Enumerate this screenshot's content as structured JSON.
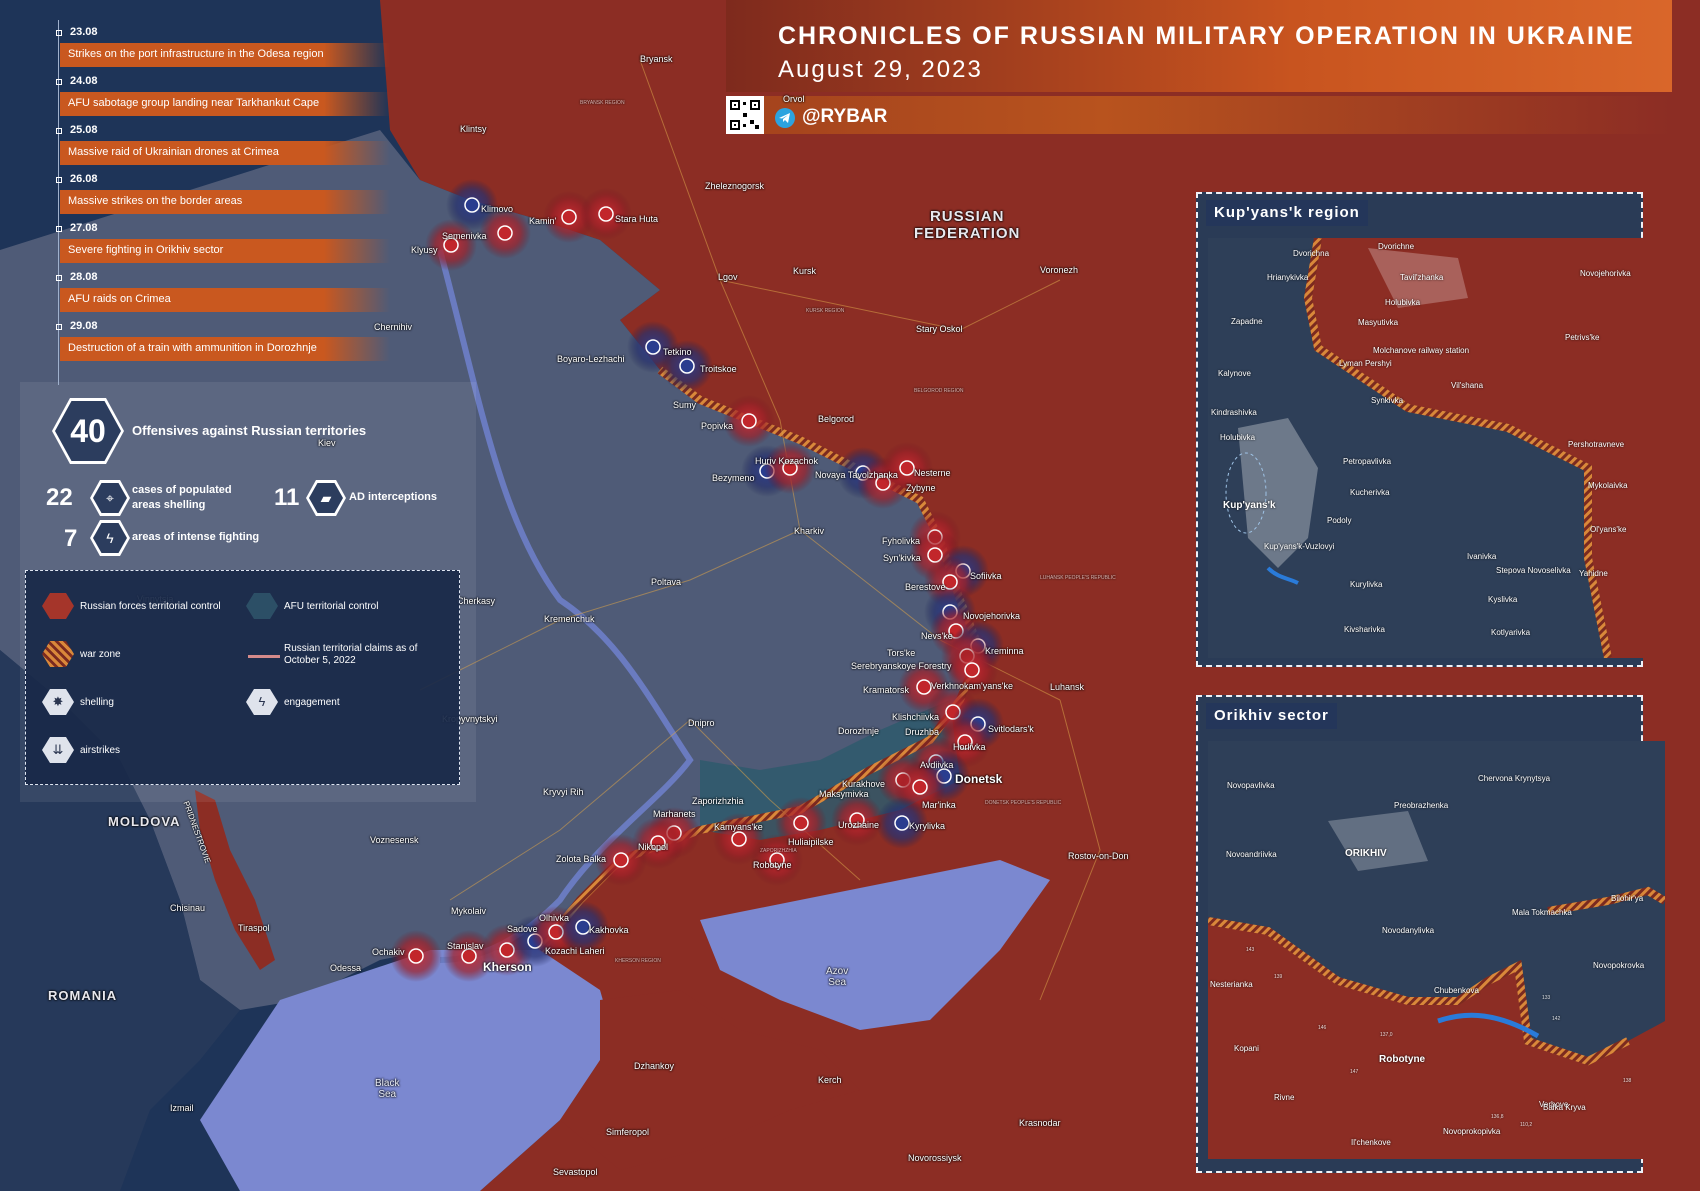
{
  "header": {
    "title": "CHRONICLES OF RUSSIAN MILITARY OPERATION IN UKRAINE",
    "date": "August 29, 2023",
    "brand": "@RYBAR",
    "orryol": "Orvol"
  },
  "timeline": [
    {
      "date": "23.08",
      "text": "Strikes on the port infrastructure in the Odesa region"
    },
    {
      "date": "24.08",
      "text": "AFU sabotage group landing near Tarkhankut Cape"
    },
    {
      "date": "25.08",
      "text": "Massive raid of Ukrainian drones at Crimea"
    },
    {
      "date": "26.08",
      "text": "Massive strikes on the border areas"
    },
    {
      "date": "27.08",
      "text": "Severe fighting in Orikhiv sector"
    },
    {
      "date": "28.08",
      "text": "AFU raids on Crimea"
    },
    {
      "date": "29.08",
      "text": "Destruction of a train with ammunition in Dorozhnje"
    }
  ],
  "stats": {
    "offensives": {
      "value": "40",
      "label": "Offensives against Russian territories"
    },
    "shelling": {
      "value": "22",
      "label": "cases of populated areas shelling"
    },
    "ad": {
      "value": "11",
      "label": "AD interceptions"
    },
    "fighting": {
      "value": "7",
      "label": "areas of intense fighting"
    }
  },
  "legend": {
    "russian_control": "Russian forces territorial control",
    "afu_control": "AFU territorial control",
    "war_zone": "war zone",
    "claims": "Russian territorial claims as of October 5, 2022",
    "shelling": "shelling",
    "engagement": "engagement",
    "airstrikes": "airstrikes"
  },
  "colors": {
    "russian": "#8a2c22",
    "afu": "#1f4a5e",
    "afu_bg": "#4c5873",
    "sea": "#7f8dd4",
    "accent": "#c9581f",
    "marker_red": "#c2262b",
    "marker_blue": "#2a3d8f"
  },
  "map_labels": {
    "russian_federation_1": "RUSSIAN",
    "russian_federation_2": "FEDERATION",
    "moldova": "MOLDOVA",
    "romania": "ROMANIA",
    "azov_sea_1": "Azov",
    "azov_sea_2": "Sea",
    "black_sea_1": "Black",
    "black_sea_2": "Sea",
    "pridnestrovie": "PRIDNESTROVIE",
    "cities": [
      "Bryansk",
      "Klintsy",
      "Zheleznogorsk",
      "Kursk",
      "Lgov",
      "Voronezh",
      "Stary Oskol",
      "Belgorod",
      "Chernihiv",
      "Sumy",
      "Kiev",
      "Poltava",
      "Kharkiv",
      "Kremenchuk",
      "Cherkasy",
      "Vinnytsia",
      "Kropyvnytskyi",
      "Dnipro",
      "Kryvyi Rih",
      "Voznesensk",
      "Mykolaiv",
      "Odessa",
      "Chisinau",
      "Tiraspol",
      "Izmail",
      "Zaporizhzhia",
      "Luhansk",
      "Donetsk",
      "Rostov-on-Don",
      "Krasnodar",
      "Novorossiysk",
      "Kerch",
      "Dzhankoy",
      "Simferopol",
      "Sevastopol",
      "Kherson",
      "Ochakiv",
      "Stanislav",
      "Sadove",
      "Olhivka",
      "Kakhovka",
      "Kozachi Laheri",
      "Zolota Balka",
      "Nikopol",
      "Marhanets",
      "Kamyans'ke",
      "Robotyne",
      "Huliaipilske",
      "Urozhaine",
      "Kyrylivka",
      "Maksymivka",
      "Kurakhove",
      "Mar'inka",
      "Avdiivka",
      "Dorozhnje",
      "Druzhba",
      "Klishchiivka",
      "Svitlodars'k",
      "Horlivka",
      "Kramatorsk",
      "Verkhnokam'yans'ke",
      "Serebryanskoye Forestry",
      "Tors'ke",
      "Kreminna",
      "Nevs'ke",
      "Novojehorivka",
      "Berestove",
      "Sofiivka",
      "Syn'kivka",
      "Fyholivka",
      "Novaya Tavolzhanka",
      "Huriv Kozachok",
      "Bezymeno",
      "Zybyne",
      "Nesterne",
      "Popivka",
      "Boyaro-Lezhachi",
      "Tetkino",
      "Troitskoe",
      "Klimovo",
      "Semenivka",
      "Klyusy",
      "Kamin'",
      "Stara Huta"
    ],
    "regions": [
      "BRYANSK REGION",
      "KURSK REGION",
      "BELGOROD REGION",
      "LUHANSK PEOPLE'S REPUBLIC",
      "DONETSK PEOPLE'S REPUBLIC",
      "KHERSON REGION",
      "ZAPORIZHZHIA"
    ]
  },
  "insets": {
    "kupyansk": {
      "title": "Kup'yans'k region",
      "labels": [
        "Dvorichna",
        "Dvorichne",
        "Tavil'zhanka",
        "Novojehorivka",
        "Hrianykivka",
        "Holubivka",
        "Masyutivka",
        "Zapadne",
        "Molchanove railway station",
        "Petrivs'ke",
        "Lyman Pershyi",
        "Kalynove",
        "Vil'shana",
        "Synkivka",
        "Kindrashivka",
        "Pershotravneve",
        "Holubivka",
        "Petropavlivka",
        "Kup'yans'k",
        "Kucherivka",
        "Mykolaivka",
        "Podoly",
        "Ol'yans'ke",
        "Kup'yans'k-Vuzlovyi",
        "Ivanivka",
        "Stepova Novoselivka",
        "Yahidne",
        "Kurylivka",
        "Kyslivka",
        "Kotlyarivka",
        "Kivsharivka"
      ]
    },
    "orikhiv": {
      "title": "Orikhiv sector",
      "labels": [
        "Novopavlivka",
        "Chervona Krynytsya",
        "Preobrazhenka",
        "Novoandriivka",
        "ORIKHIV",
        "Mala Tokmachka",
        "Bilohir'ya",
        "Novodanylivka",
        "Nesterianka",
        "Novopokrovka",
        "Chubenkova",
        "Kopani",
        "Robotyne",
        "Rivne",
        "Verbove",
        "Balka Kryva",
        "Il'chenkove",
        "Novoprokopivka"
      ],
      "heights": [
        "143",
        "139",
        "146",
        "147",
        "137,0",
        "142",
        "133",
        "138",
        "136,8",
        "110,2"
      ]
    }
  }
}
